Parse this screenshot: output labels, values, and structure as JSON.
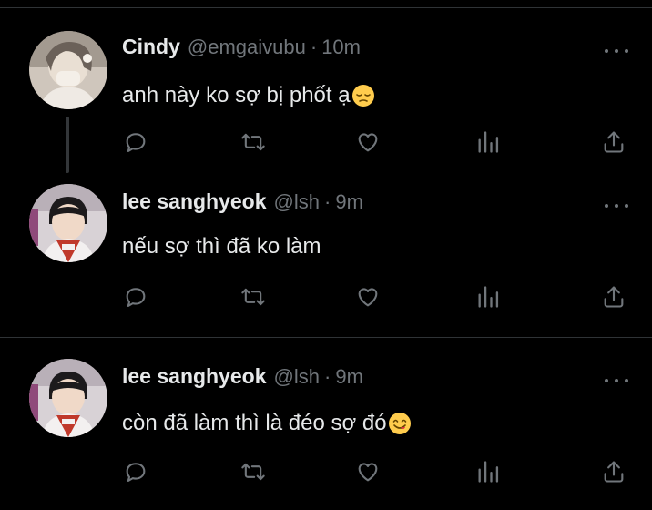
{
  "colors": {
    "background": "#000000",
    "text": "#e7e9ea",
    "secondary": "#71767b",
    "divider": "#2f3336"
  },
  "tweets": [
    {
      "name": "Cindy",
      "handle": "@emgaivubu",
      "separator": "·",
      "time": "10m",
      "text": "anh này ko sợ bị phốt ạ",
      "emoji": "pensive-face",
      "avatar": "cindy-avatar"
    },
    {
      "name": "lee sanghyeok",
      "handle": "@lsh",
      "separator": "·",
      "time": "9m",
      "text": "nếu sợ thì đã ko làm",
      "emoji": "",
      "avatar": "lsh-avatar"
    },
    {
      "name": "lee sanghyeok",
      "handle": "@lsh",
      "separator": "·",
      "time": "9m",
      "text": "còn đã làm thì là đéo sợ đó",
      "emoji": "yum-face",
      "avatar": "lsh-avatar"
    }
  ],
  "action_icons": [
    "reply-icon",
    "retweet-icon",
    "like-icon",
    "views-icon",
    "share-icon"
  ]
}
